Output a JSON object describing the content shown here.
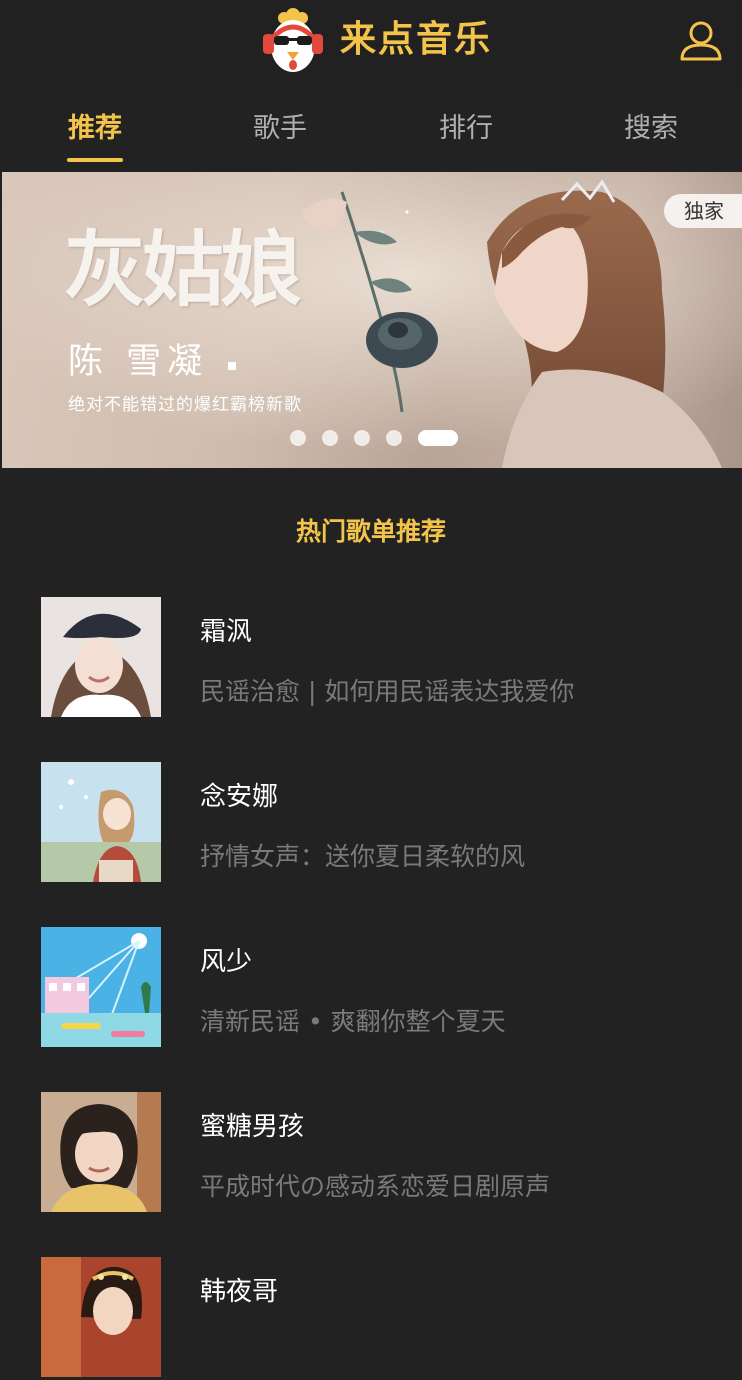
{
  "header": {
    "app_title": "来点音乐"
  },
  "tabs": [
    {
      "label": "推荐",
      "active": true
    },
    {
      "label": "歌手",
      "active": false
    },
    {
      "label": "排行",
      "active": false
    },
    {
      "label": "搜索",
      "active": false
    }
  ],
  "banner": {
    "title": "灰姑娘",
    "artist": "陈 雪凝",
    "tagline": "绝对不能错过的爆红霸榜新歌",
    "badge": "独家",
    "slide_count": 5,
    "active_slide": 5
  },
  "section": {
    "title": "热门歌单推荐"
  },
  "playlists": [
    {
      "name": "霜沨",
      "desc": "民谣治愈 | 如何用民谣表达我爱你"
    },
    {
      "name": "念安娜",
      "desc": "抒情女声：送你夏日柔软的风"
    },
    {
      "name": "风少",
      "desc": "清新民谣 • 爽翻你整个夏天"
    },
    {
      "name": "蜜糖男孩",
      "desc": "平成时代の感动系恋爱日剧原声"
    },
    {
      "name": "韩夜哥",
      "desc": ""
    }
  ],
  "colors": {
    "accent": "#f3c34a",
    "background": "#222222",
    "secondary_text": "#7a7a7a",
    "logo_headphone": "#e2483b"
  },
  "icons": {
    "logo": "rooster-headphones-icon",
    "user": "user-icon"
  }
}
